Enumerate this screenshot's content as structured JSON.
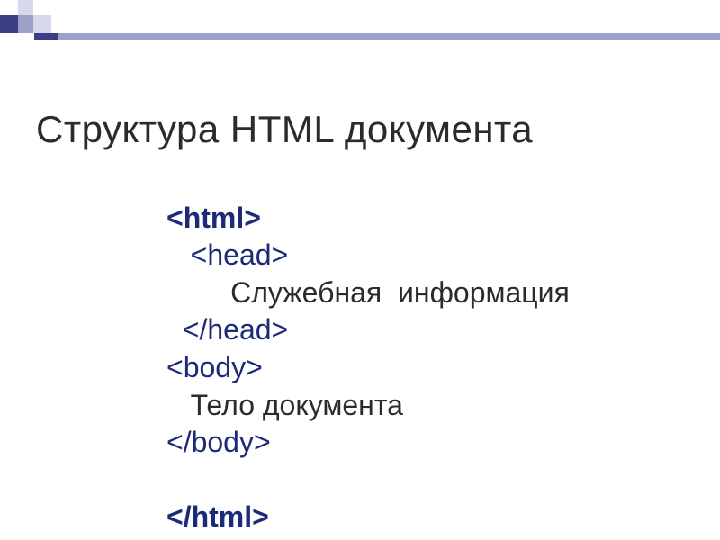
{
  "title": "Структура HTML документа",
  "code": {
    "l1": "<html>",
    "l2": "<head>",
    "l3": "Служебная  информация",
    "l4": "</head>",
    "l5": "<body>",
    "l6": "Тело документа",
    "l7": "</body>",
    "l8": "</html>"
  },
  "colors": {
    "dark": "#3b3e85",
    "mid": "#9aa0c8",
    "light": "#d6d9ea"
  }
}
